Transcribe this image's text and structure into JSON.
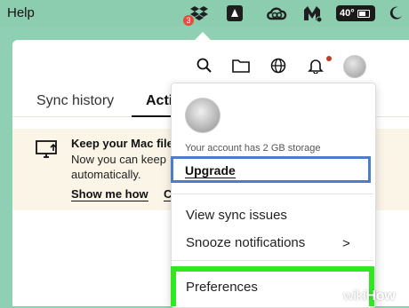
{
  "menubar": {
    "help_label": "Help",
    "dropbox_badge": "3",
    "temperature": "40°",
    "icons": [
      "dropbox-icon",
      "arrow-square-icon",
      "creative-cloud-icon",
      "malwarebytes-icon",
      "temperature-pill",
      "moon-icon"
    ]
  },
  "toolbar": {
    "icons": [
      "search-icon",
      "folder-icon",
      "globe-icon",
      "bell-icon",
      "avatar"
    ]
  },
  "tabs": [
    {
      "label": "Sync history"
    },
    {
      "label": "Acti"
    }
  ],
  "banner": {
    "title": "Keep your Mac file",
    "line1": "Now you can keep",
    "line2": "automatically.",
    "link1": "Show me how",
    "link2": "C"
  },
  "dropdown": {
    "storage_text": "Your account has 2 GB storage",
    "upgrade_label": "Upgrade",
    "items": [
      {
        "label": "View sync issues"
      },
      {
        "label": "Snooze notifications",
        "submenu_glyph": ">"
      },
      {
        "label": "Preferences"
      }
    ]
  },
  "watermark": {
    "wiki": "wiki",
    "how": "How"
  },
  "colors": {
    "background": "#8fcfb3",
    "upgrade_highlight": "#4a7fc8",
    "preferences_highlight": "#2ee820",
    "banner_bg": "#fbf5e8"
  }
}
